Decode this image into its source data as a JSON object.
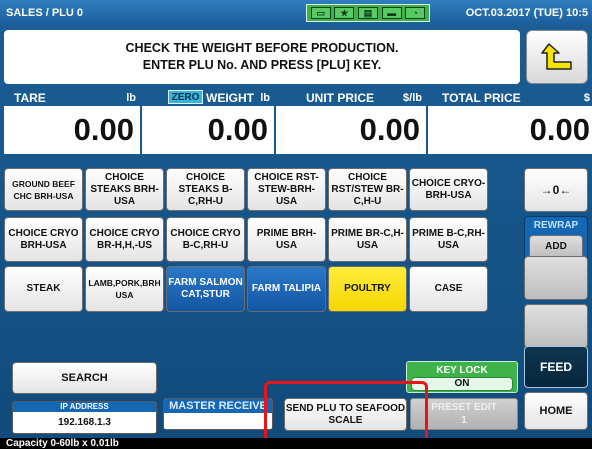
{
  "title": "SALES / PLU 0",
  "datetime": "OCT.03.2017 (TUE) 10:5",
  "message": {
    "line1": "CHECK THE WEIGHT BEFORE PRODUCTION.",
    "line2": "ENTER PLU No. AND PRESS [PLU] KEY."
  },
  "fields": {
    "tare": {
      "label": "TARE",
      "unit": "lb",
      "value": "0.00"
    },
    "zero": "ZERO",
    "weight": {
      "label": "WEIGHT",
      "unit": "lb",
      "value": "0.00"
    },
    "unit_price": {
      "label": "UNIT PRICE",
      "unit": "$/lb",
      "value": "0.00"
    },
    "total_price": {
      "label": "TOTAL PRICE",
      "unit": "$",
      "value": "0.00"
    }
  },
  "grid": {
    "row1": [
      "GROUND BEEF CHC BRH-USA",
      "CHOICE STEAKS BRH-USA",
      "CHOICE STEAKS B-C,RH-U",
      "CHOICE RST-STEW-BRH-USA",
      "CHOICE RST/STEW BR-C,H-U",
      "CHOICE CRYO-BRH-USA"
    ],
    "row2": [
      "CHOICE CRYO BRH-USA",
      "CHOICE CRYO BR-H,H,-US",
      "CHOICE CRYO B-C,RH-U",
      "PRIME BRH-USA",
      "PRIME BR-C,H-USA",
      "PRIME B-C,RH-USA"
    ],
    "row3": [
      "STEAK",
      "LAMB,PORK,BRH USA",
      "FARM SALMON CAT,STUR",
      "FARM TALIPIA",
      "POULTRY",
      "CASE"
    ]
  },
  "side": {
    "tare_key": "→0←",
    "rewrap": "REWRAP",
    "add": "ADD",
    "feed": "FEED",
    "home": "HOME"
  },
  "bottom": {
    "search": "SEARCH",
    "key_lock": "KEY LOCK",
    "key_lock_state": "ON",
    "ip_label": "IP ADDRESS",
    "ip_value": "192.168.1.3",
    "master_receive": "MASTER RECEIVE",
    "send_plu": "SEND PLU TO SEAFOOD SCALE",
    "preset_edit": "PRESET EDIT",
    "preset_num": "1"
  },
  "capacity": "Capacity 0-60lb x 0.01lb",
  "colors": {
    "screen_bg": "#1b5f96",
    "highlight": "#e8141b",
    "keylock": "#3fb34a",
    "zero_badge": "#37b4d8"
  }
}
